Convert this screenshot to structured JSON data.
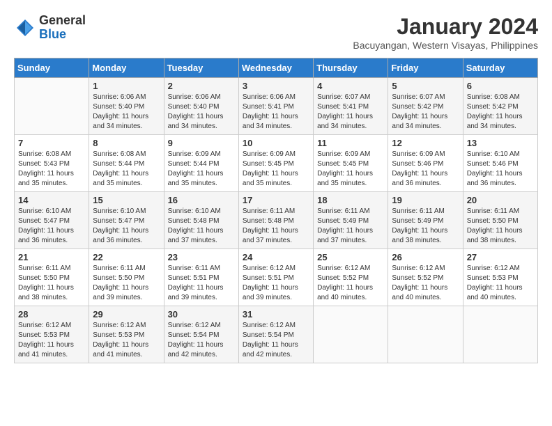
{
  "header": {
    "logo_general": "General",
    "logo_blue": "Blue",
    "month_year": "January 2024",
    "location": "Bacuyangan, Western Visayas, Philippines"
  },
  "days_of_week": [
    "Sunday",
    "Monday",
    "Tuesday",
    "Wednesday",
    "Thursday",
    "Friday",
    "Saturday"
  ],
  "weeks": [
    [
      {
        "num": "",
        "sunrise": "",
        "sunset": "",
        "daylight": ""
      },
      {
        "num": "1",
        "sunrise": "Sunrise: 6:06 AM",
        "sunset": "Sunset: 5:40 PM",
        "daylight": "Daylight: 11 hours and 34 minutes."
      },
      {
        "num": "2",
        "sunrise": "Sunrise: 6:06 AM",
        "sunset": "Sunset: 5:40 PM",
        "daylight": "Daylight: 11 hours and 34 minutes."
      },
      {
        "num": "3",
        "sunrise": "Sunrise: 6:06 AM",
        "sunset": "Sunset: 5:41 PM",
        "daylight": "Daylight: 11 hours and 34 minutes."
      },
      {
        "num": "4",
        "sunrise": "Sunrise: 6:07 AM",
        "sunset": "Sunset: 5:41 PM",
        "daylight": "Daylight: 11 hours and 34 minutes."
      },
      {
        "num": "5",
        "sunrise": "Sunrise: 6:07 AM",
        "sunset": "Sunset: 5:42 PM",
        "daylight": "Daylight: 11 hours and 34 minutes."
      },
      {
        "num": "6",
        "sunrise": "Sunrise: 6:08 AM",
        "sunset": "Sunset: 5:42 PM",
        "daylight": "Daylight: 11 hours and 34 minutes."
      }
    ],
    [
      {
        "num": "7",
        "sunrise": "Sunrise: 6:08 AM",
        "sunset": "Sunset: 5:43 PM",
        "daylight": "Daylight: 11 hours and 35 minutes."
      },
      {
        "num": "8",
        "sunrise": "Sunrise: 6:08 AM",
        "sunset": "Sunset: 5:44 PM",
        "daylight": "Daylight: 11 hours and 35 minutes."
      },
      {
        "num": "9",
        "sunrise": "Sunrise: 6:09 AM",
        "sunset": "Sunset: 5:44 PM",
        "daylight": "Daylight: 11 hours and 35 minutes."
      },
      {
        "num": "10",
        "sunrise": "Sunrise: 6:09 AM",
        "sunset": "Sunset: 5:45 PM",
        "daylight": "Daylight: 11 hours and 35 minutes."
      },
      {
        "num": "11",
        "sunrise": "Sunrise: 6:09 AM",
        "sunset": "Sunset: 5:45 PM",
        "daylight": "Daylight: 11 hours and 35 minutes."
      },
      {
        "num": "12",
        "sunrise": "Sunrise: 6:09 AM",
        "sunset": "Sunset: 5:46 PM",
        "daylight": "Daylight: 11 hours and 36 minutes."
      },
      {
        "num": "13",
        "sunrise": "Sunrise: 6:10 AM",
        "sunset": "Sunset: 5:46 PM",
        "daylight": "Daylight: 11 hours and 36 minutes."
      }
    ],
    [
      {
        "num": "14",
        "sunrise": "Sunrise: 6:10 AM",
        "sunset": "Sunset: 5:47 PM",
        "daylight": "Daylight: 11 hours and 36 minutes."
      },
      {
        "num": "15",
        "sunrise": "Sunrise: 6:10 AM",
        "sunset": "Sunset: 5:47 PM",
        "daylight": "Daylight: 11 hours and 36 minutes."
      },
      {
        "num": "16",
        "sunrise": "Sunrise: 6:10 AM",
        "sunset": "Sunset: 5:48 PM",
        "daylight": "Daylight: 11 hours and 37 minutes."
      },
      {
        "num": "17",
        "sunrise": "Sunrise: 6:11 AM",
        "sunset": "Sunset: 5:48 PM",
        "daylight": "Daylight: 11 hours and 37 minutes."
      },
      {
        "num": "18",
        "sunrise": "Sunrise: 6:11 AM",
        "sunset": "Sunset: 5:49 PM",
        "daylight": "Daylight: 11 hours and 37 minutes."
      },
      {
        "num": "19",
        "sunrise": "Sunrise: 6:11 AM",
        "sunset": "Sunset: 5:49 PM",
        "daylight": "Daylight: 11 hours and 38 minutes."
      },
      {
        "num": "20",
        "sunrise": "Sunrise: 6:11 AM",
        "sunset": "Sunset: 5:50 PM",
        "daylight": "Daylight: 11 hours and 38 minutes."
      }
    ],
    [
      {
        "num": "21",
        "sunrise": "Sunrise: 6:11 AM",
        "sunset": "Sunset: 5:50 PM",
        "daylight": "Daylight: 11 hours and 38 minutes."
      },
      {
        "num": "22",
        "sunrise": "Sunrise: 6:11 AM",
        "sunset": "Sunset: 5:50 PM",
        "daylight": "Daylight: 11 hours and 39 minutes."
      },
      {
        "num": "23",
        "sunrise": "Sunrise: 6:11 AM",
        "sunset": "Sunset: 5:51 PM",
        "daylight": "Daylight: 11 hours and 39 minutes."
      },
      {
        "num": "24",
        "sunrise": "Sunrise: 6:12 AM",
        "sunset": "Sunset: 5:51 PM",
        "daylight": "Daylight: 11 hours and 39 minutes."
      },
      {
        "num": "25",
        "sunrise": "Sunrise: 6:12 AM",
        "sunset": "Sunset: 5:52 PM",
        "daylight": "Daylight: 11 hours and 40 minutes."
      },
      {
        "num": "26",
        "sunrise": "Sunrise: 6:12 AM",
        "sunset": "Sunset: 5:52 PM",
        "daylight": "Daylight: 11 hours and 40 minutes."
      },
      {
        "num": "27",
        "sunrise": "Sunrise: 6:12 AM",
        "sunset": "Sunset: 5:53 PM",
        "daylight": "Daylight: 11 hours and 40 minutes."
      }
    ],
    [
      {
        "num": "28",
        "sunrise": "Sunrise: 6:12 AM",
        "sunset": "Sunset: 5:53 PM",
        "daylight": "Daylight: 11 hours and 41 minutes."
      },
      {
        "num": "29",
        "sunrise": "Sunrise: 6:12 AM",
        "sunset": "Sunset: 5:53 PM",
        "daylight": "Daylight: 11 hours and 41 minutes."
      },
      {
        "num": "30",
        "sunrise": "Sunrise: 6:12 AM",
        "sunset": "Sunset: 5:54 PM",
        "daylight": "Daylight: 11 hours and 42 minutes."
      },
      {
        "num": "31",
        "sunrise": "Sunrise: 6:12 AM",
        "sunset": "Sunset: 5:54 PM",
        "daylight": "Daylight: 11 hours and 42 minutes."
      },
      {
        "num": "",
        "sunrise": "",
        "sunset": "",
        "daylight": ""
      },
      {
        "num": "",
        "sunrise": "",
        "sunset": "",
        "daylight": ""
      },
      {
        "num": "",
        "sunrise": "",
        "sunset": "",
        "daylight": ""
      }
    ]
  ]
}
